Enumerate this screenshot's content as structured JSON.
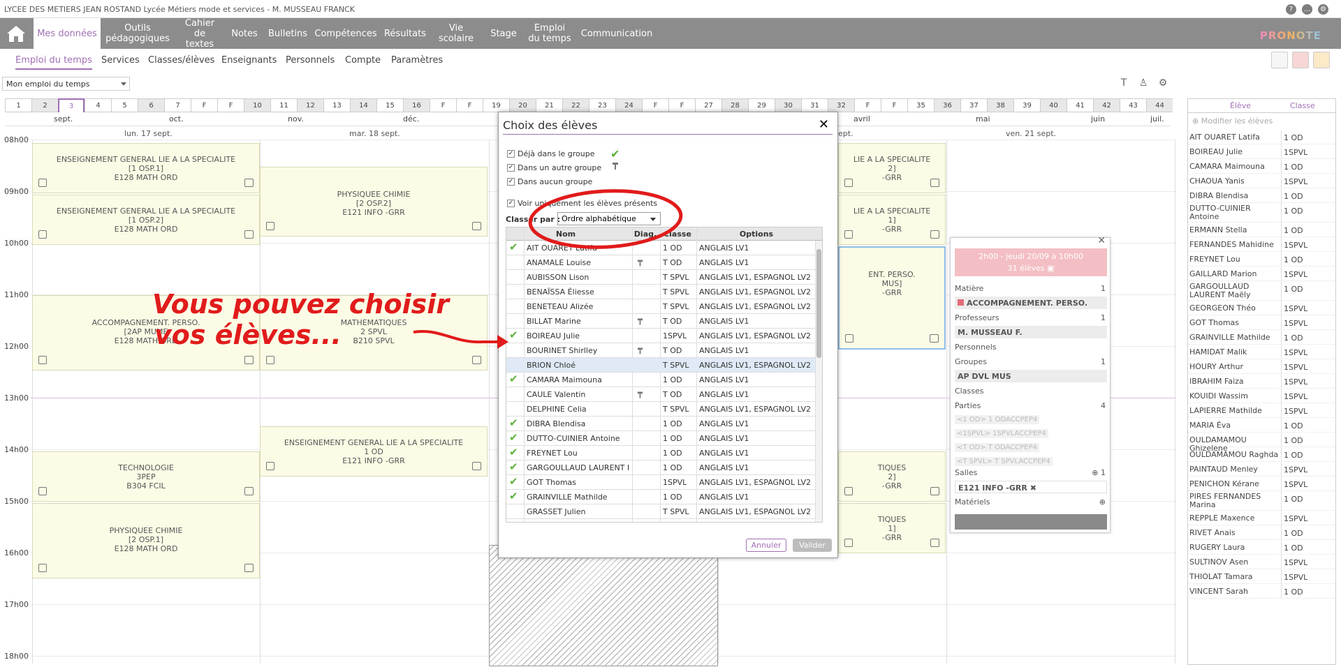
{
  "app": {
    "title": "LYCEE DES METIERS JEAN ROSTAND Lycée Métiers mode et services - M. MUSSEAU FRANCK",
    "brand": "PRONOTE"
  },
  "mainnav": [
    {
      "label": "Mes données",
      "active": true
    },
    {
      "label": "Outils\npédagogiques"
    },
    {
      "label": "Cahier\nde textes"
    },
    {
      "label": "Notes"
    },
    {
      "label": "Bulletins"
    },
    {
      "label": "Compétences"
    },
    {
      "label": "Résultats"
    },
    {
      "label": "Vie\nscolaire"
    },
    {
      "label": "Stage"
    },
    {
      "label": "Emploi\ndu temps"
    },
    {
      "label": "Communication"
    }
  ],
  "subnav": [
    {
      "label": "Emploi du temps",
      "active": true
    },
    {
      "label": "Services"
    },
    {
      "label": "Classes/élèves"
    },
    {
      "label": "Enseignants"
    },
    {
      "label": "Personnels"
    },
    {
      "label": "Compte"
    },
    {
      "label": "Paramètres"
    }
  ],
  "toolbar": {
    "select_value": "Mon emploi du temps"
  },
  "weeks": [
    "1",
    "2",
    "3",
    "4",
    "5",
    "6",
    "7",
    "F",
    "F",
    "10",
    "11",
    "12",
    "13",
    "14",
    "15",
    "16",
    "F",
    "F",
    "19",
    "20",
    "21",
    "22",
    "23",
    "24",
    "F",
    "F",
    "27",
    "28",
    "29",
    "30",
    "31",
    "32",
    "F",
    "F",
    "35",
    "36",
    "37",
    "38",
    "39",
    "40",
    "41",
    "42",
    "43",
    "44"
  ],
  "selected_week": "3",
  "months": [
    "sept.",
    "oct.",
    "nov.",
    "déc.",
    "avril",
    "mai",
    "juin",
    "juil."
  ],
  "hours": [
    "08h00",
    "09h00",
    "10h00",
    "11h00",
    "12h00",
    "13h00",
    "14h00",
    "15h00",
    "16h00",
    "17h00",
    "18h00"
  ],
  "days": [
    "lun. 17 sept.",
    "mar. 18 sept.",
    "ept.",
    "ven. 21 sept."
  ],
  "courses": [
    {
      "lines": [
        "ENSEIGNEMENT GENERAL LIE A LA SPECIALITE",
        "[1 OSP.1]",
        "E128 MATH ORD"
      ]
    },
    {
      "lines": [
        "ENSEIGNEMENT GENERAL LIE A LA SPECIALITE",
        "[1 OSP.2]",
        "E128 MATH ORD"
      ]
    },
    {
      "lines": [
        "ACCOMPAGNEMENT. PERSO.",
        "[2AP MUME",
        "E128 MATH ORD"
      ]
    },
    {
      "lines": [
        "TECHNOLOGIE",
        "3PEP",
        "B304 FCIL"
      ]
    },
    {
      "lines": [
        "PHYSIQUEE CHIMIE",
        "[2 OSP.1]",
        "E128 MATH ORD"
      ]
    },
    {
      "lines": [
        "PHYSIQUEE CHIMIE",
        "[2 OSP.2]",
        "E121 INFO -GRR"
      ]
    },
    {
      "lines": [
        "MATHEMATIQUES",
        "2 SPVL",
        "B210 SPVL"
      ]
    },
    {
      "lines": [
        "ENSEIGNEMENT GENERAL LIE A LA SPECIALITE",
        "1 OD",
        "E121 INFO -GRR"
      ]
    },
    {
      "lines": [
        "LIE A LA SPECIALITE",
        "2]",
        "-GRR"
      ]
    },
    {
      "lines": [
        "LIE A LA SPECIALITE",
        "1]",
        "-GRR"
      ]
    },
    {
      "lines": [
        "ENT. PERSO.",
        "MUS]",
        "-GRR"
      ]
    },
    {
      "lines": [
        "TIQUES",
        "2]",
        "-GRR"
      ]
    },
    {
      "lines": [
        "TIQUES",
        "1]",
        "-GRR"
      ]
    }
  ],
  "annotation": {
    "line1": "Vous pouvez choisir",
    "line2": "vos élèves...",
    "color": "#e11b1b"
  },
  "modal": {
    "title": "Choix des élèves",
    "filters": [
      {
        "label": "Déjà dans le groupe",
        "checked": true
      },
      {
        "label": "Dans un autre groupe",
        "checked": true
      },
      {
        "label": "Dans aucun groupe",
        "checked": true
      }
    ],
    "present_only": {
      "label": "Voir uniquement les élèves présents",
      "checked": true
    },
    "sort_label": "Classer par :",
    "sort_value": "Ordre alphabétique",
    "columns": [
      "Nom",
      "Diag.",
      "Classe",
      "Options"
    ],
    "rows": [
      {
        "tick": true,
        "name": "AIT OUAREТ Latifa",
        "pin": false,
        "classe": "1 OD",
        "options": "ANGLAIS LV1"
      },
      {
        "tick": false,
        "name": "ANAMALE Louise",
        "pin": true,
        "classe": "T OD",
        "options": "ANGLAIS LV1"
      },
      {
        "tick": false,
        "name": "AUBISSON Lison",
        "pin": false,
        "classe": "T SPVL",
        "options": "ANGLAIS LV1, ESPAGNOL LV2"
      },
      {
        "tick": false,
        "name": "BENAÏSSA Éliesse",
        "pin": false,
        "classe": "T SPVL",
        "options": "ANGLAIS LV1, ESPAGNOL LV2"
      },
      {
        "tick": false,
        "name": "BENETEAU Alizée",
        "pin": false,
        "classe": "T SPVL",
        "options": "ANGLAIS LV1, ESPAGNOL LV2"
      },
      {
        "tick": false,
        "name": "BILLAT Marine",
        "pin": true,
        "classe": "T OD",
        "options": "ANGLAIS LV1"
      },
      {
        "tick": true,
        "name": "BOIREAU Julie",
        "pin": false,
        "classe": "1SPVL",
        "options": "ANGLAIS LV1, ESPAGNOL LV2"
      },
      {
        "tick": false,
        "name": "BOURINET Shirlley",
        "pin": true,
        "classe": "T OD",
        "options": "ANGLAIS LV1"
      },
      {
        "tick": false,
        "name": "BRION Chloé",
        "pin": false,
        "classe": "T SPVL",
        "options": "ANGLAIS LV1, ESPAGNOL LV2",
        "hl": true
      },
      {
        "tick": true,
        "name": "CAMARA Maimouna",
        "pin": false,
        "classe": "1 OD",
        "options": "ANGLAIS LV1"
      },
      {
        "tick": false,
        "name": "CAULE Valentin",
        "pin": true,
        "classe": "T OD",
        "options": "ANGLAIS LV1"
      },
      {
        "tick": false,
        "name": "DELPHINE Celia",
        "pin": false,
        "classe": "T SPVL",
        "options": "ANGLAIS LV1, ESPAGNOL LV2"
      },
      {
        "tick": true,
        "name": "DIBRA Blendisa",
        "pin": false,
        "classe": "1 OD",
        "options": "ANGLAIS LV1"
      },
      {
        "tick": true,
        "name": "DUTTO-CUINIER Antoine",
        "pin": false,
        "classe": "1 OD",
        "options": "ANGLAIS LV1"
      },
      {
        "tick": true,
        "name": "FREYNET Lou",
        "pin": false,
        "classe": "1 OD",
        "options": "ANGLAIS LV1"
      },
      {
        "tick": true,
        "name": "GARGOULLAUD LAURENT I",
        "pin": false,
        "classe": "1 OD",
        "options": "ANGLAIS LV1"
      },
      {
        "tick": true,
        "name": "GOT Thomas",
        "pin": false,
        "classe": "1SPVL",
        "options": "ANGLAIS LV1, ESPAGNOL LV2"
      },
      {
        "tick": true,
        "name": "GRAINVILLE Mathilde",
        "pin": false,
        "classe": "1 OD",
        "options": "ANGLAIS LV1"
      },
      {
        "tick": false,
        "name": "GRASSET Julien",
        "pin": false,
        "classe": "T SPVL",
        "options": "ANGLAIS LV1, ESPAGNOL LV2"
      }
    ],
    "cancel_label": "Annuler",
    "ok_label": "Valider"
  },
  "detail": {
    "header_line1": "2h00 - jeudi 20/09 à 10h00",
    "header_line2": "31 élèves",
    "matiere_label": "Matière",
    "matiere_count": "1",
    "matiere_value": "ACCOMPAGNEMENT. PERSO.",
    "prof_label": "Professeurs",
    "prof_count": "1",
    "prof_value": "M. MUSSEAU F.",
    "personnels_label": "Personnels",
    "groupes_label": "Groupes",
    "groupes_count": "1",
    "groupes_value": "AP DVL MUS",
    "classes_label": "Classes",
    "parties_label": "Parties",
    "parties_count": "4",
    "parties": [
      "<1 OD> 1 ODACCPEP4",
      "<1SPVL> 1SPVLACCPEP4",
      "<T OD> T ODACCPEP4",
      "<T SPVL> T SPVLACCPEP4"
    ],
    "salles_label": "Salles",
    "salles_count": "1",
    "salles_value": "E121 INFO -GRR",
    "materiels_label": "Matériels"
  },
  "students_panel": {
    "col_eleve": "Élève",
    "col_classe": "Classe",
    "modify_label": "Modifier les élèves",
    "students": [
      {
        "name": "AIT OUARET Latifa",
        "classe": "1 OD"
      },
      {
        "name": "BOIREAU Julie",
        "classe": "1SPVL"
      },
      {
        "name": "CAMARA Maimouna",
        "classe": "1 OD"
      },
      {
        "name": "CHAOUA Yanis",
        "classe": "1SPVL"
      },
      {
        "name": "DIBRA Blendisa",
        "classe": "1 OD"
      },
      {
        "name": "DUTTO-CUINIER Antoine",
        "classe": "1 OD"
      },
      {
        "name": "ERMANN Stella",
        "classe": "1 OD"
      },
      {
        "name": "FERNANDES Mahidine",
        "classe": "1SPVL"
      },
      {
        "name": "FREYNET Lou",
        "classe": "1 OD"
      },
      {
        "name": "GAILLARD Marion",
        "classe": "1SPVL"
      },
      {
        "name": "GARGOULLAUD LAURENT Maëly",
        "classe": "1 OD"
      },
      {
        "name": "GEORGEON Théo",
        "classe": "1SPVL"
      },
      {
        "name": "GOT Thomas",
        "classe": "1SPVL"
      },
      {
        "name": "GRAINVILLE Mathilde",
        "classe": "1 OD"
      },
      {
        "name": "HAMIDAT Malik",
        "classe": "1SPVL"
      },
      {
        "name": "HOURY Arthur",
        "classe": "1SPVL"
      },
      {
        "name": "IBRAHIM Faiza",
        "classe": "1SPVL"
      },
      {
        "name": "KOUIDI Wassim",
        "classe": "1SPVL"
      },
      {
        "name": "LAPIERRE Mathilde",
        "classe": "1SPVL"
      },
      {
        "name": "MARIA Éva",
        "classe": "1 OD"
      },
      {
        "name": "OULDAMAMOU Ghizelene",
        "classe": "1 OD"
      },
      {
        "name": "OULDAMAMOU Raghda",
        "classe": "1 OD"
      },
      {
        "name": "PAINTAUD Menley",
        "classe": "1SPVL"
      },
      {
        "name": "PENICHON Kérane",
        "classe": "1SPVL"
      },
      {
        "name": "PIRES FERNANDES Marina",
        "classe": "1 OD"
      },
      {
        "name": "REPPLE Maxence",
        "classe": "1SPVL"
      },
      {
        "name": "RIVET Anais",
        "classe": "1 OD"
      },
      {
        "name": "RUGERY Laura",
        "classe": "1 OD"
      },
      {
        "name": "SULTINOV Asen",
        "classe": "1SPVL"
      },
      {
        "name": "THIOLAT Tamara",
        "classe": "1SPVL"
      },
      {
        "name": "VINCENT Sarah",
        "classe": "1 OD"
      }
    ]
  },
  "colors": {
    "accent": "#a06fb5",
    "nav": "#8c8c8c",
    "course_bg": "#fcfce6",
    "tick": "#5cb33a",
    "annotation": "#e11b1b"
  }
}
